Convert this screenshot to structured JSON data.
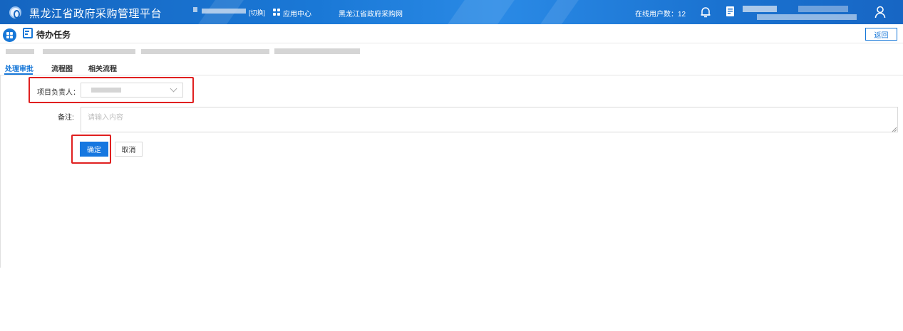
{
  "header": {
    "site_title": "黑龙江省政府采购管理平台",
    "switch_label": "[切换]",
    "apps_label": "应用中心",
    "gov_link": "黑龙江省政府采购网",
    "online_users_label": "在线用户数：12"
  },
  "page": {
    "title": "待办任务",
    "back_label": "返回"
  },
  "tabs": [
    {
      "label": "处理审批",
      "active": true
    },
    {
      "label": "流程图",
      "active": false
    },
    {
      "label": "相关流程",
      "active": false
    }
  ],
  "form": {
    "project_owner_label": "项目负责人：",
    "remark_label": "备注:",
    "remark_placeholder": "请输入内容",
    "confirm_label": "确定",
    "cancel_label": "取消"
  },
  "colors": {
    "primary": "#1677d8",
    "highlight": "#e02020"
  }
}
